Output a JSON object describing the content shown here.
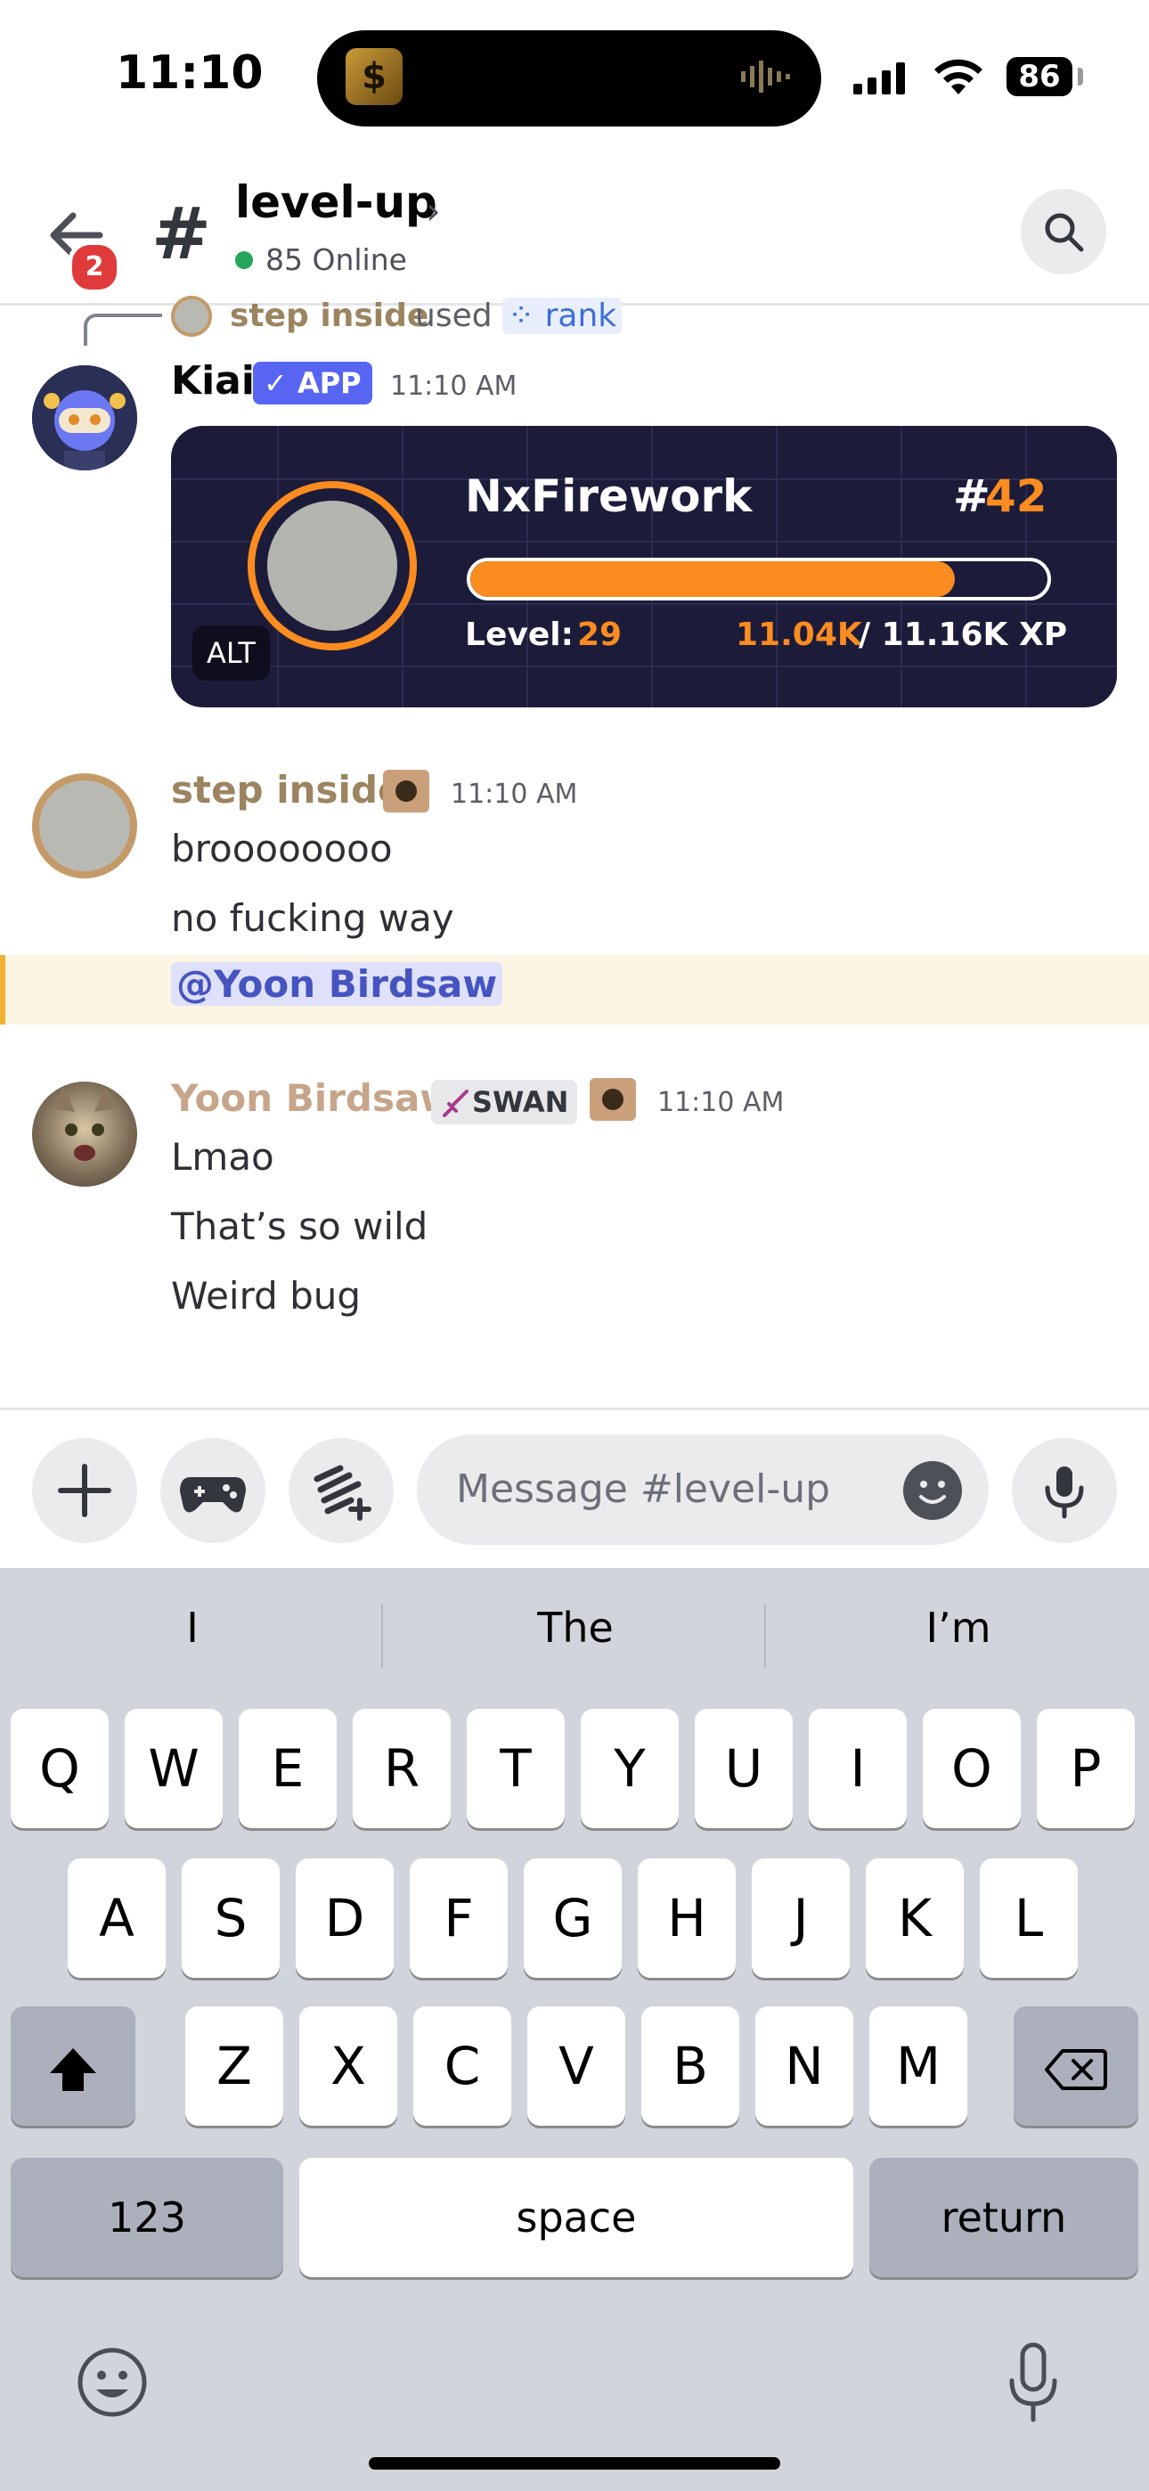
{
  "status_bar": {
    "time": "11:10",
    "battery": "86",
    "island_app_glyph": "$"
  },
  "header": {
    "back_badge": "2",
    "hash": "#",
    "channel_name": "level-up",
    "chevron": "›",
    "online": "85 Online"
  },
  "reply": {
    "name": "step inside",
    "used": "used",
    "command": "⁘ rank"
  },
  "messages": {
    "kiai": {
      "name": "Kiai",
      "tag": "✓ APP",
      "time": "11:10 AM",
      "card": {
        "username": "NxFirework",
        "rank_hash": "#",
        "rank": "42",
        "level_label": "Level:",
        "level": "29",
        "xp_current": "11.04K",
        "xp_rest": "/ 11.16K XP",
        "progress_fraction": 0.84,
        "alt": "ALT"
      }
    },
    "step": {
      "name": "step inside",
      "time": "11:10 AM",
      "lines": [
        "broooooooo",
        "no fucking way"
      ],
      "mention": "@Yoon Birdsaw"
    },
    "yoon": {
      "name": "Yoon Birdsaw",
      "tag": "SWAN",
      "time": "11:10 AM",
      "lines": [
        "Lmao",
        "That’s so wild",
        "Weird bug"
      ]
    }
  },
  "composer": {
    "placeholder": "Message #level-up"
  },
  "keyboard": {
    "suggestions": [
      "I",
      "The",
      "I’m"
    ],
    "row1": [
      "Q",
      "W",
      "E",
      "R",
      "T",
      "Y",
      "U",
      "I",
      "O",
      "P"
    ],
    "row2": [
      "A",
      "S",
      "D",
      "F",
      "G",
      "H",
      "J",
      "K",
      "L"
    ],
    "row3": [
      "Z",
      "X",
      "C",
      "V",
      "B",
      "N",
      "M"
    ],
    "numbers": "123",
    "space": "space",
    "return": "return"
  },
  "colors": {
    "accent": "#fb8c1f",
    "blurple": "#5865f2",
    "online": "#23a55a",
    "badge": "#e03b3b"
  }
}
